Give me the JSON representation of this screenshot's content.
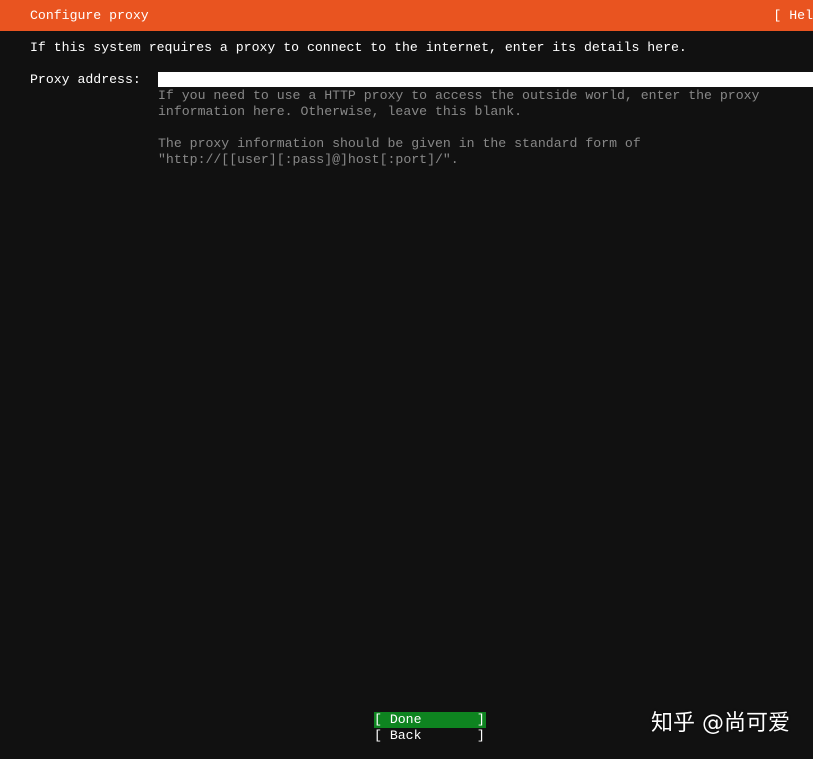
{
  "header": {
    "title": "Configure proxy",
    "help_label": "[ Hel"
  },
  "intro": "If this system requires a proxy to connect to the internet, enter its details here.",
  "proxy": {
    "label": "Proxy address:",
    "value": "",
    "help_lines": [
      "If you need to use a HTTP proxy to access the outside world, enter the proxy",
      "information here. Otherwise, leave this blank.",
      "The proxy information should be given in the standard form of",
      "\"http://[[user][:pass]@]host[:port]/\"."
    ]
  },
  "buttons": {
    "done": "[ Done       ]",
    "back": "[ Back       ]"
  },
  "watermark": "知乎 @尚可爱",
  "theme": {
    "background": "#111111",
    "accent": "#E95420",
    "text": "#FFFFFF",
    "muted_text": "#888888",
    "field": "#FFFFFF",
    "focus_button": "#0E8420"
  }
}
